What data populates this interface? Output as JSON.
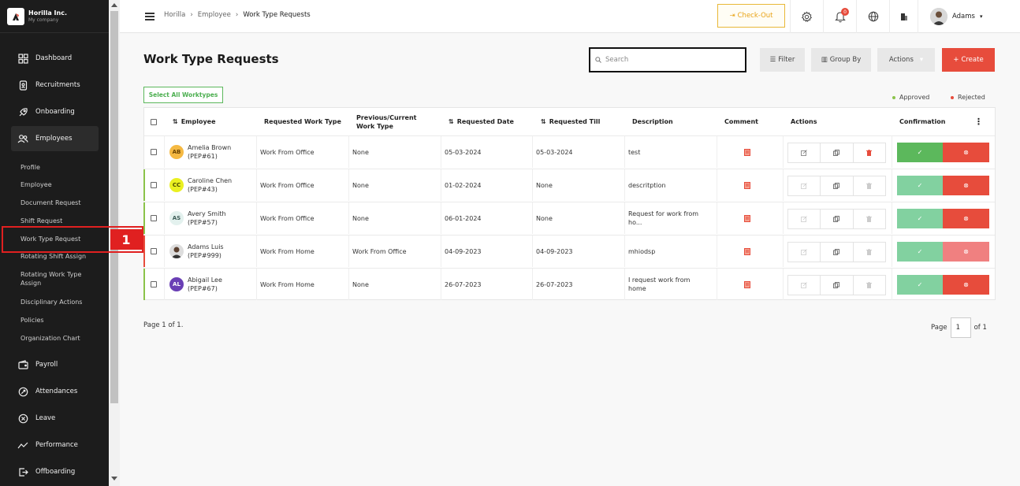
{
  "brand": {
    "name": "Horilla Inc.",
    "company": "My company"
  },
  "nav": [
    {
      "label": "Dashboard",
      "icon": "dashboard-icon"
    },
    {
      "label": "Recruitments",
      "icon": "recruitment-icon"
    },
    {
      "label": "Onboarding",
      "icon": "onboarding-icon"
    },
    {
      "label": "Employees",
      "icon": "employees-icon"
    },
    {
      "label": "Payroll",
      "icon": "wallet-icon"
    },
    {
      "label": "Attendances",
      "icon": "attendance-icon"
    },
    {
      "label": "Leave",
      "icon": "leave-icon"
    },
    {
      "label": "Performance",
      "icon": "performance-icon"
    },
    {
      "label": "Offboarding",
      "icon": "offboarding-icon"
    }
  ],
  "submenu": [
    "Profile",
    "Employee",
    "Document Request",
    "Shift Request",
    "Work Type Request",
    "Rotating Shift Assign",
    "Rotating Work Type Assign",
    "Disciplinary Actions",
    "Policies",
    "Organization Chart"
  ],
  "annotation_number": "1",
  "breadcrumb": [
    "Horilla",
    "Employee",
    "Work Type Requests"
  ],
  "topbar": {
    "checkout_label": "Check-Out",
    "notification_count": "0",
    "user_name": "Adams"
  },
  "page": {
    "title": "Work Type Requests",
    "search_placeholder": "Search",
    "filter_label": "Filter",
    "groupby_label": "Group By",
    "actions_label": "Actions",
    "create_label": "Create",
    "select_all_label": "Select All Worktypes",
    "legend_approved": "Approved",
    "legend_rejected": "Rejected"
  },
  "table": {
    "headers": {
      "employee": "Employee",
      "requested_work_type": "Requested Work Type",
      "previous": "Previous/Current Work Type",
      "requested_date": "Requested Date",
      "requested_till": "Requested Till",
      "description": "Description",
      "comment": "Comment",
      "actions": "Actions",
      "confirmation": "Confirmation"
    },
    "rows": [
      {
        "initials": "AB",
        "name": "Amelia Brown",
        "id": "(PEP#61)",
        "requested": "Work From Office",
        "previous": "None",
        "date": "05-03-2024",
        "till": "05-03-2024",
        "description": "test",
        "status": "approved"
      },
      {
        "initials": "CC",
        "name": "Caroline Chen",
        "id": "(PEP#43)",
        "requested": "Work From Office",
        "previous": "None",
        "date": "01-02-2024",
        "till": "None",
        "description": "descritption",
        "status": "approved"
      },
      {
        "initials": "AS",
        "name": "Avery Smith",
        "id": "(PEP#57)",
        "requested": "Work From Office",
        "previous": "None",
        "date": "06-01-2024",
        "till": "None",
        "description": "Request for work from ho...",
        "status": "approved"
      },
      {
        "initials": "",
        "name": "Adams Luis",
        "id": "(PEP#999)",
        "requested": "Work From Home",
        "previous": "Work From Office",
        "date": "04-09-2023",
        "till": "04-09-2023",
        "description": "mhiodsp",
        "status": "rejected"
      },
      {
        "initials": "AL",
        "name": "Abigail Lee",
        "id": "(PEP#67)",
        "requested": "Work From Home",
        "previous": "None",
        "date": "26-07-2023",
        "till": "26-07-2023",
        "description": "I request work from home",
        "status": "approved"
      }
    ]
  },
  "pagination": {
    "info": "Page 1 of 1.",
    "page_label": "Page",
    "current": "1",
    "of_label": "of 1"
  },
  "colors": {
    "accent": "#e74c3c",
    "approved": "#5cb85c",
    "rejected": "#e74c3c",
    "sidebar": "#1c1c1c"
  }
}
